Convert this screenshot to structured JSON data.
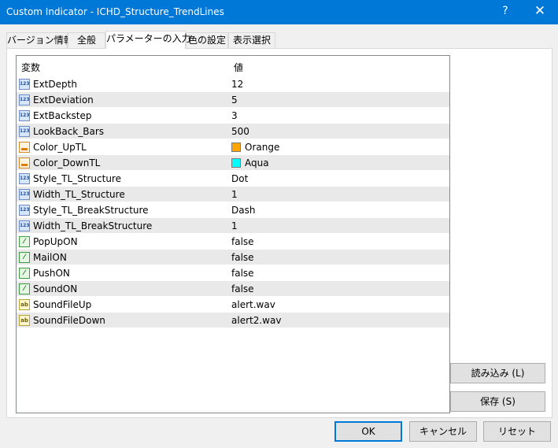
{
  "window": {
    "title": "Custom Indicator - ICHD_Structure_TrendLines",
    "help": "?",
    "close": "✕"
  },
  "tabs": [
    {
      "label": "バージョン情報",
      "active": false
    },
    {
      "label": "全般",
      "active": false
    },
    {
      "label": "パラメーターの入力",
      "active": true
    },
    {
      "label": "色の設定",
      "active": false
    },
    {
      "label": "表示選択",
      "active": false
    }
  ],
  "grid": {
    "headers": {
      "variable": "変数",
      "value": "値"
    },
    "rows": [
      {
        "icon": "integer-icon",
        "name": "ExtDepth",
        "value": "12"
      },
      {
        "icon": "integer-icon",
        "name": "ExtDeviation",
        "value": "5"
      },
      {
        "icon": "integer-icon",
        "name": "ExtBackstep",
        "value": "3"
      },
      {
        "icon": "integer-icon",
        "name": "LookBack_Bars",
        "value": "500"
      },
      {
        "icon": "color-icon",
        "name": "Color_UpTL",
        "value": "Orange",
        "swatch": "#FFA500"
      },
      {
        "icon": "color-icon",
        "name": "Color_DownTL",
        "value": "Aqua",
        "swatch": "#00FFFF"
      },
      {
        "icon": "integer-icon",
        "name": "Style_TL_Structure",
        "value": "Dot"
      },
      {
        "icon": "integer-icon",
        "name": "Width_TL_Structure",
        "value": "1"
      },
      {
        "icon": "integer-icon",
        "name": "Style_TL_BreakStructure",
        "value": "Dash"
      },
      {
        "icon": "integer-icon",
        "name": "Width_TL_BreakStructure",
        "value": "1"
      },
      {
        "icon": "boolean-icon",
        "name": "PopUpON",
        "value": "false"
      },
      {
        "icon": "boolean-icon",
        "name": "MailON",
        "value": "false"
      },
      {
        "icon": "boolean-icon",
        "name": "PushON",
        "value": "false"
      },
      {
        "icon": "boolean-icon",
        "name": "SoundON",
        "value": "false"
      },
      {
        "icon": "string-icon",
        "name": "SoundFileUp",
        "value": "alert.wav"
      },
      {
        "icon": "string-icon",
        "name": "SoundFileDown",
        "value": "alert2.wav"
      }
    ]
  },
  "side_buttons": {
    "load": "読み込み (L)",
    "save": "保存 (S)"
  },
  "footer_buttons": {
    "ok": "OK",
    "cancel": "キャンセル",
    "reset": "リセット"
  },
  "colors": {
    "titlebar": "#0078d7",
    "accent": "#0078d7"
  }
}
